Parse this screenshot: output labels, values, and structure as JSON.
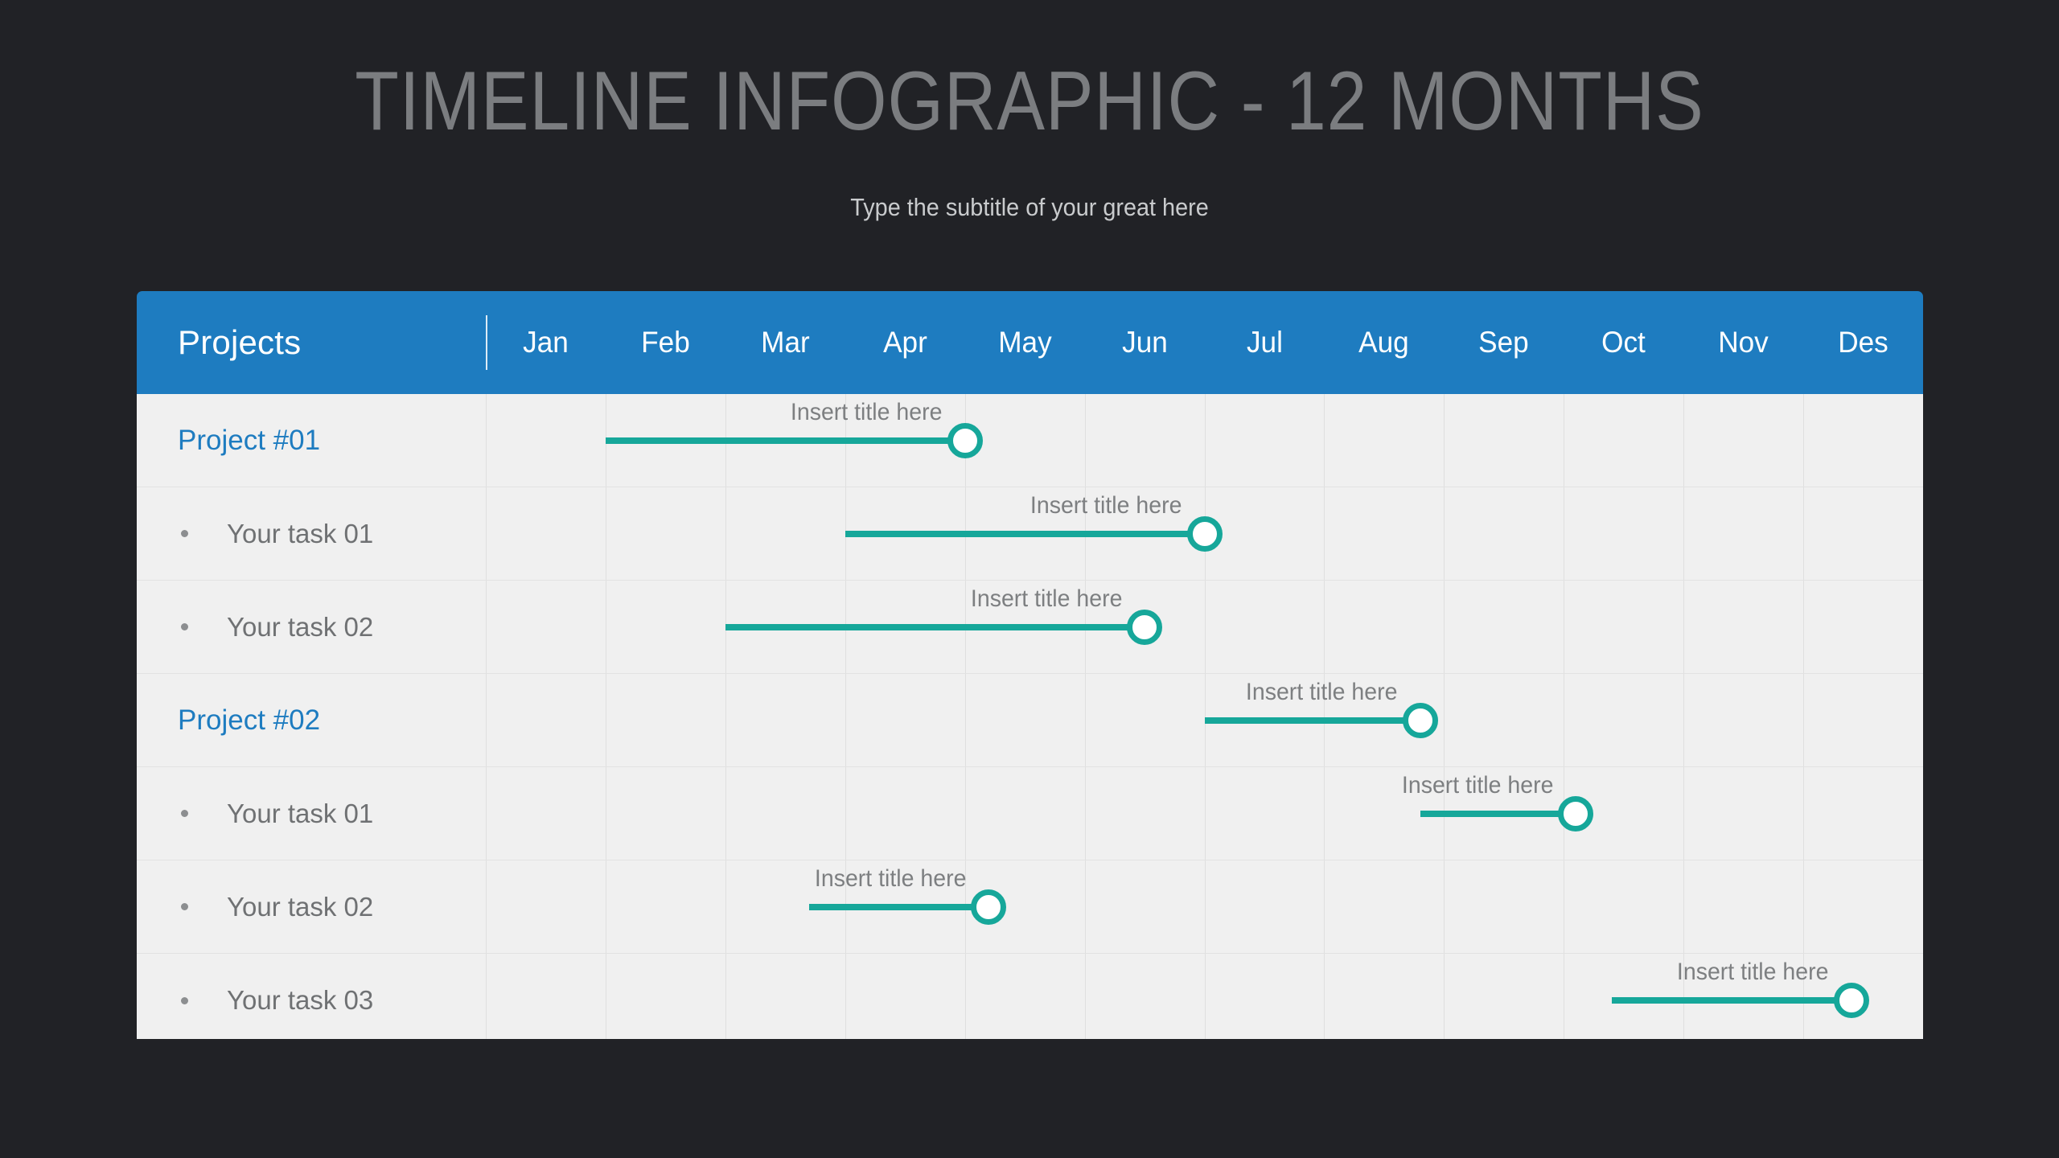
{
  "header": {
    "title": "TIMELINE INFOGRAPHIC - 12 MONTHS",
    "subtitle": "Type the subtitle of your great here"
  },
  "colors": {
    "background": "#212226",
    "header_blue": "#1E7CC0",
    "bar_teal": "#16A79A",
    "row_background": "#F0F0F0",
    "title_gray": "#7B7D80",
    "label_gray": "#6F7173"
  },
  "table": {
    "projects_header": "Projects",
    "months": [
      "Jan",
      "Feb",
      "Mar",
      "Apr",
      "May",
      "Jun",
      "Jul",
      "Aug",
      "Sep",
      "Oct",
      "Nov",
      "Des"
    ],
    "rows": [
      {
        "label": "Project #01",
        "type": "project",
        "bar_label": "Insert title here",
        "start_month": 1,
        "end_month": 4
      },
      {
        "label": "Your task 01",
        "type": "task",
        "bar_label": "Insert title here",
        "start_month": 3,
        "end_month": 6
      },
      {
        "label": "Your task 02",
        "type": "task",
        "bar_label": "Insert title here",
        "start_month": 2,
        "end_month": 5.5
      },
      {
        "label": "Project #02",
        "type": "project",
        "bar_label": "Insert title here",
        "start_month": 6,
        "end_month": 7.8
      },
      {
        "label": "Your task 01",
        "type": "task",
        "bar_label": "Insert title here",
        "start_month": 7.8,
        "end_month": 9.1
      },
      {
        "label": "Your task 02",
        "type": "task",
        "bar_label": "Insert title here",
        "start_month": 2.7,
        "end_month": 4.2
      },
      {
        "label": "Your task 03",
        "type": "task",
        "bar_label": "Insert title here",
        "start_month": 9.4,
        "end_month": 11.4
      }
    ]
  },
  "chart_data": {
    "type": "bar",
    "title": "TIMELINE INFOGRAPHIC - 12 MONTHS",
    "subtitle": "Type the subtitle of your great here",
    "xlabel": "",
    "ylabel": "Projects",
    "categories": [
      "Jan",
      "Feb",
      "Mar",
      "Apr",
      "May",
      "Jun",
      "Jul",
      "Aug",
      "Sep",
      "Oct",
      "Nov",
      "Des"
    ],
    "series": [
      {
        "name": "Project #01",
        "start": 1,
        "end": 4
      },
      {
        "name": "Your task 01",
        "start": 3,
        "end": 6
      },
      {
        "name": "Your task 02",
        "start": 2,
        "end": 5.5
      },
      {
        "name": "Project #02",
        "start": 6,
        "end": 7.8
      },
      {
        "name": "Your task 01",
        "start": 7.8,
        "end": 9.1
      },
      {
        "name": "Your task 02",
        "start": 2.7,
        "end": 4.2
      },
      {
        "name": "Your task 03",
        "start": 9.4,
        "end": 11.4
      }
    ],
    "xlim": [
      0,
      12
    ],
    "grid": true,
    "legend": "none"
  }
}
